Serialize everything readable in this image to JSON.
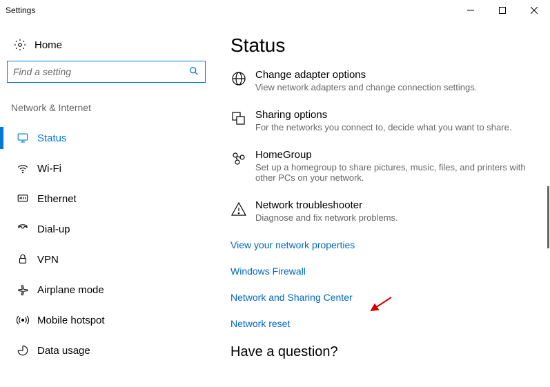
{
  "titlebar": {
    "title": "Settings"
  },
  "sidebar": {
    "home_label": "Home",
    "search_placeholder": "Find a setting",
    "category_label": "Network & Internet",
    "items": [
      {
        "label": "Status"
      },
      {
        "label": "Wi-Fi"
      },
      {
        "label": "Ethernet"
      },
      {
        "label": "Dial-up"
      },
      {
        "label": "VPN"
      },
      {
        "label": "Airplane mode"
      },
      {
        "label": "Mobile hotspot"
      },
      {
        "label": "Data usage"
      }
    ]
  },
  "main": {
    "title": "Status",
    "options": [
      {
        "title": "Change adapter options",
        "desc": "View network adapters and change connection settings."
      },
      {
        "title": "Sharing options",
        "desc": "For the networks you connect to, decide what you want to share."
      },
      {
        "title": "HomeGroup",
        "desc": "Set up a homegroup to share pictures, music, files, and printers with other PCs on your network."
      },
      {
        "title": "Network troubleshooter",
        "desc": "Diagnose and fix network problems."
      }
    ],
    "links": [
      "View your network properties",
      "Windows Firewall",
      "Network and Sharing Center",
      "Network reset"
    ],
    "question": "Have a question?"
  }
}
